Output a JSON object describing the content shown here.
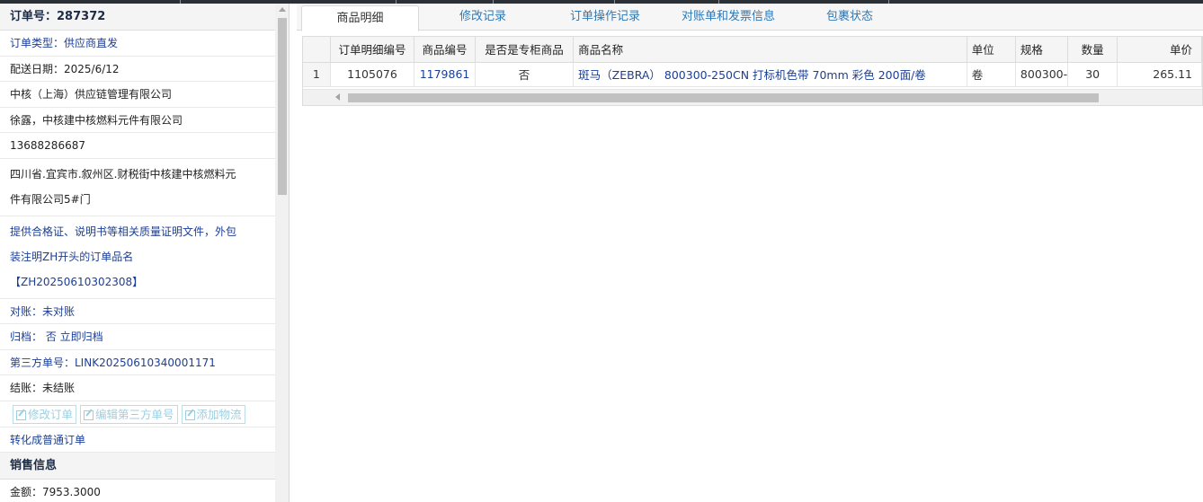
{
  "order": {
    "number_label": "订单号：",
    "number_value": "287372",
    "type": "订单类型：供应商直发",
    "delivery_date": "配送日期：2025/6/12",
    "company": "中核（上海）供应链管理有限公司",
    "contact": "徐露，中核建中核燃料元件有限公司",
    "phone": "13688286687",
    "address_line1": "四川省.宜宾市.叙州区.财税街中核建中核燃料元",
    "address_line2": "件有限公司5#门",
    "remark_line1": "提供合格证、说明书等相关质量证明文件，外包",
    "remark_line2": "装注明ZH开头的订单品名",
    "remark_line3": "【ZH20250610302308】",
    "reconcile": "对账：未对账",
    "archive": "归档：  否  立即归档",
    "third_party": "第三方单号：LINK20250610340001171",
    "settlement": "结账：未结账",
    "convert_link": "转化成普通订单"
  },
  "buttons": {
    "edit_order": "修改订单",
    "edit_third_party": "编辑第三方单号",
    "add_logistics": "添加物流"
  },
  "sales": {
    "header": "销售信息",
    "amount": "金额：7953.3000"
  },
  "tabs": [
    "商品明细",
    "修改记录",
    "订单操作记录",
    "对账单和发票信息",
    "包裹状态"
  ],
  "table": {
    "headers": [
      "",
      "订单明细编号",
      "商品编号",
      "是否是专柜商品",
      "商品名称",
      "单位",
      "规格",
      "数量",
      "单价"
    ],
    "rows": [
      [
        "1",
        "1105076",
        "1179861",
        "否",
        "斑马（ZEBRA） 800300-250CN 打标机色带 70mm 彩色 200面/卷",
        "卷",
        "800300-",
        "30",
        "265.11"
      ]
    ]
  },
  "colors": {
    "link_blue": "#1c3f95",
    "tab_blue": "#2e78b7",
    "disabled_button": "#9ccfe0"
  }
}
